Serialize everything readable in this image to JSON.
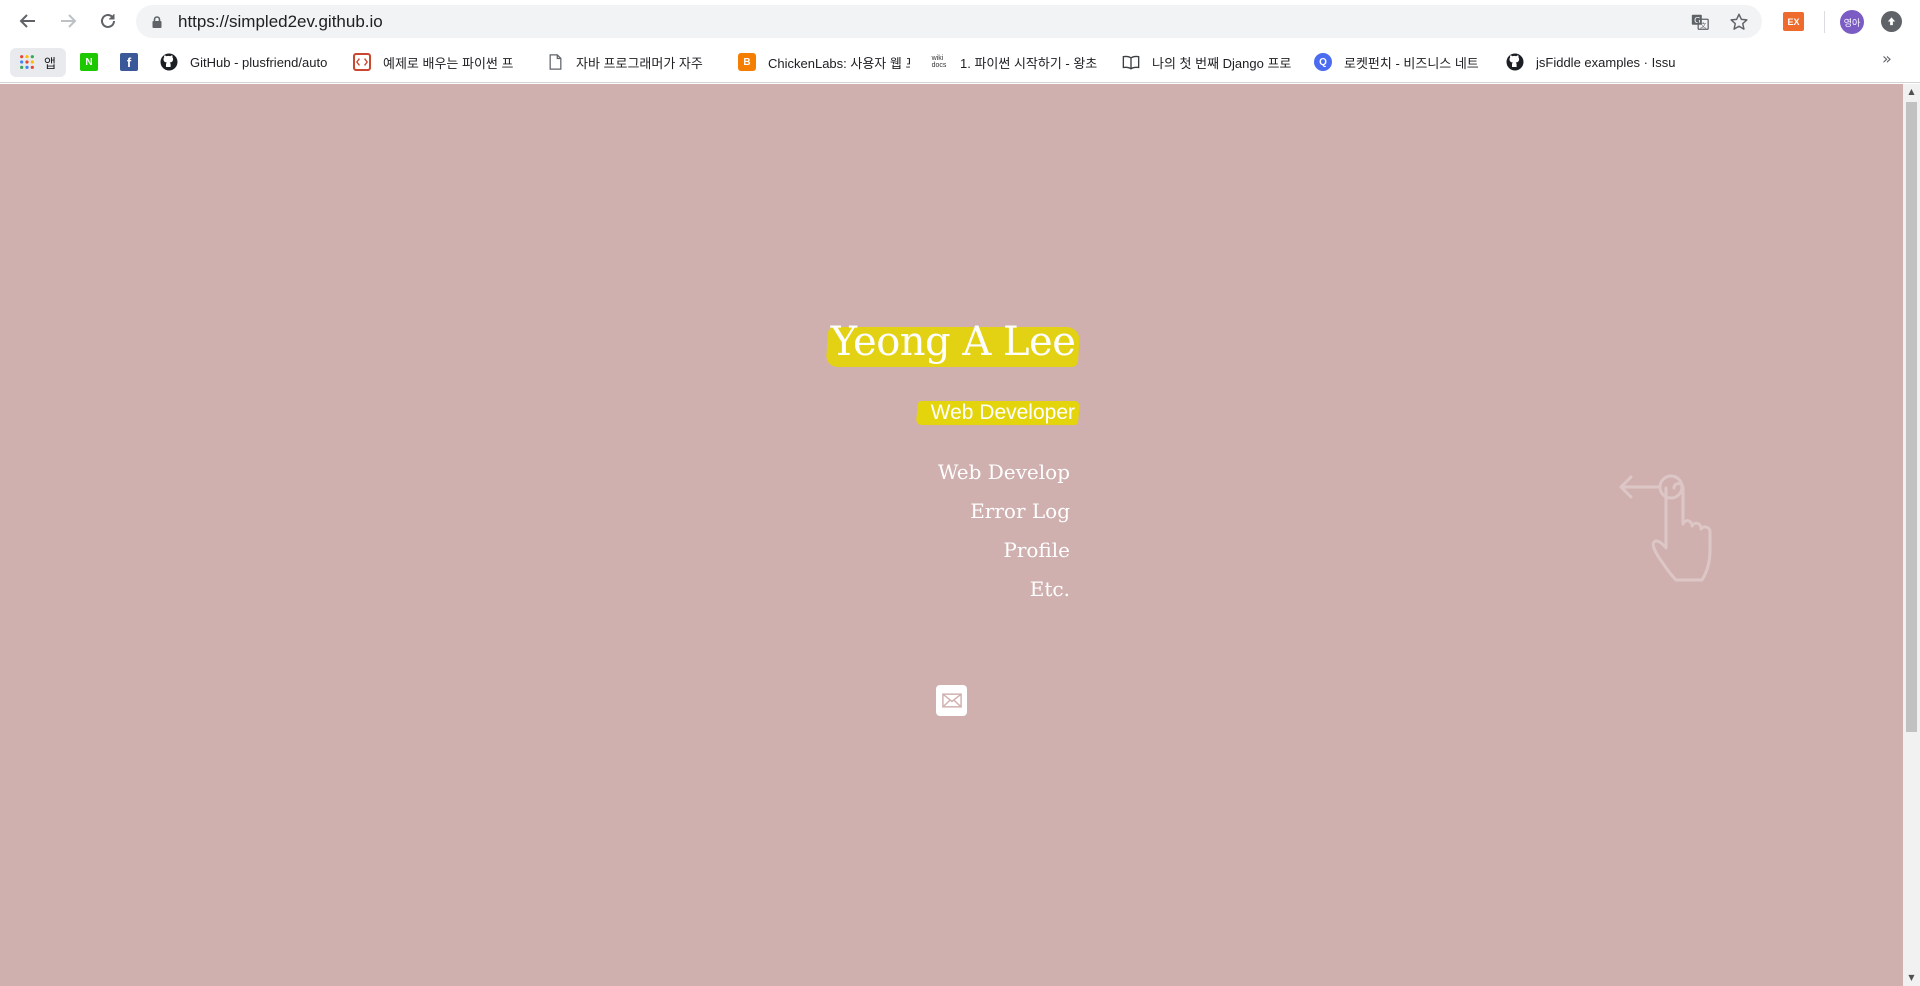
{
  "browser": {
    "url": "https://simpled2ev.github.io",
    "profile_initials": "영아",
    "extension_label": "EX",
    "bookmarks": [
      {
        "label": "앱",
        "icon": "apps-grid-icon"
      },
      {
        "label": "",
        "icon": "naver-icon"
      },
      {
        "label": "",
        "icon": "facebook-icon"
      },
      {
        "label": "GitHub - plusfriend/auto",
        "icon": "github-icon"
      },
      {
        "label": "예제로 배우는 파이썬 프",
        "icon": "code-bracket-icon"
      },
      {
        "label": "자바 프로그래머가 자주",
        "icon": "document-icon"
      },
      {
        "label": "ChickenLabs: 사용자 웹 프",
        "icon": "blogger-icon"
      },
      {
        "label": "1. 파이썬 시작하기 - 왕초",
        "icon": "wikidocs-icon"
      },
      {
        "label": "나의 첫 번째 Django 프로",
        "icon": "book-icon"
      },
      {
        "label": "로켓펀치 - 비즈니스 네트",
        "icon": "rocketpunch-icon"
      },
      {
        "label": "jsFiddle examples · Issue",
        "icon": "github-icon"
      }
    ],
    "more_bookmarks": "»"
  },
  "page": {
    "background": "#cfb0af",
    "highlight": "#e4d40b",
    "name": "Yeong A Lee",
    "role": "Web Developer",
    "menu": [
      "Web Develop",
      "Error Log",
      "Profile",
      "Etc."
    ],
    "contact_icon": "mail-icon",
    "hint_icon": "swipe-left-hand-icon"
  }
}
